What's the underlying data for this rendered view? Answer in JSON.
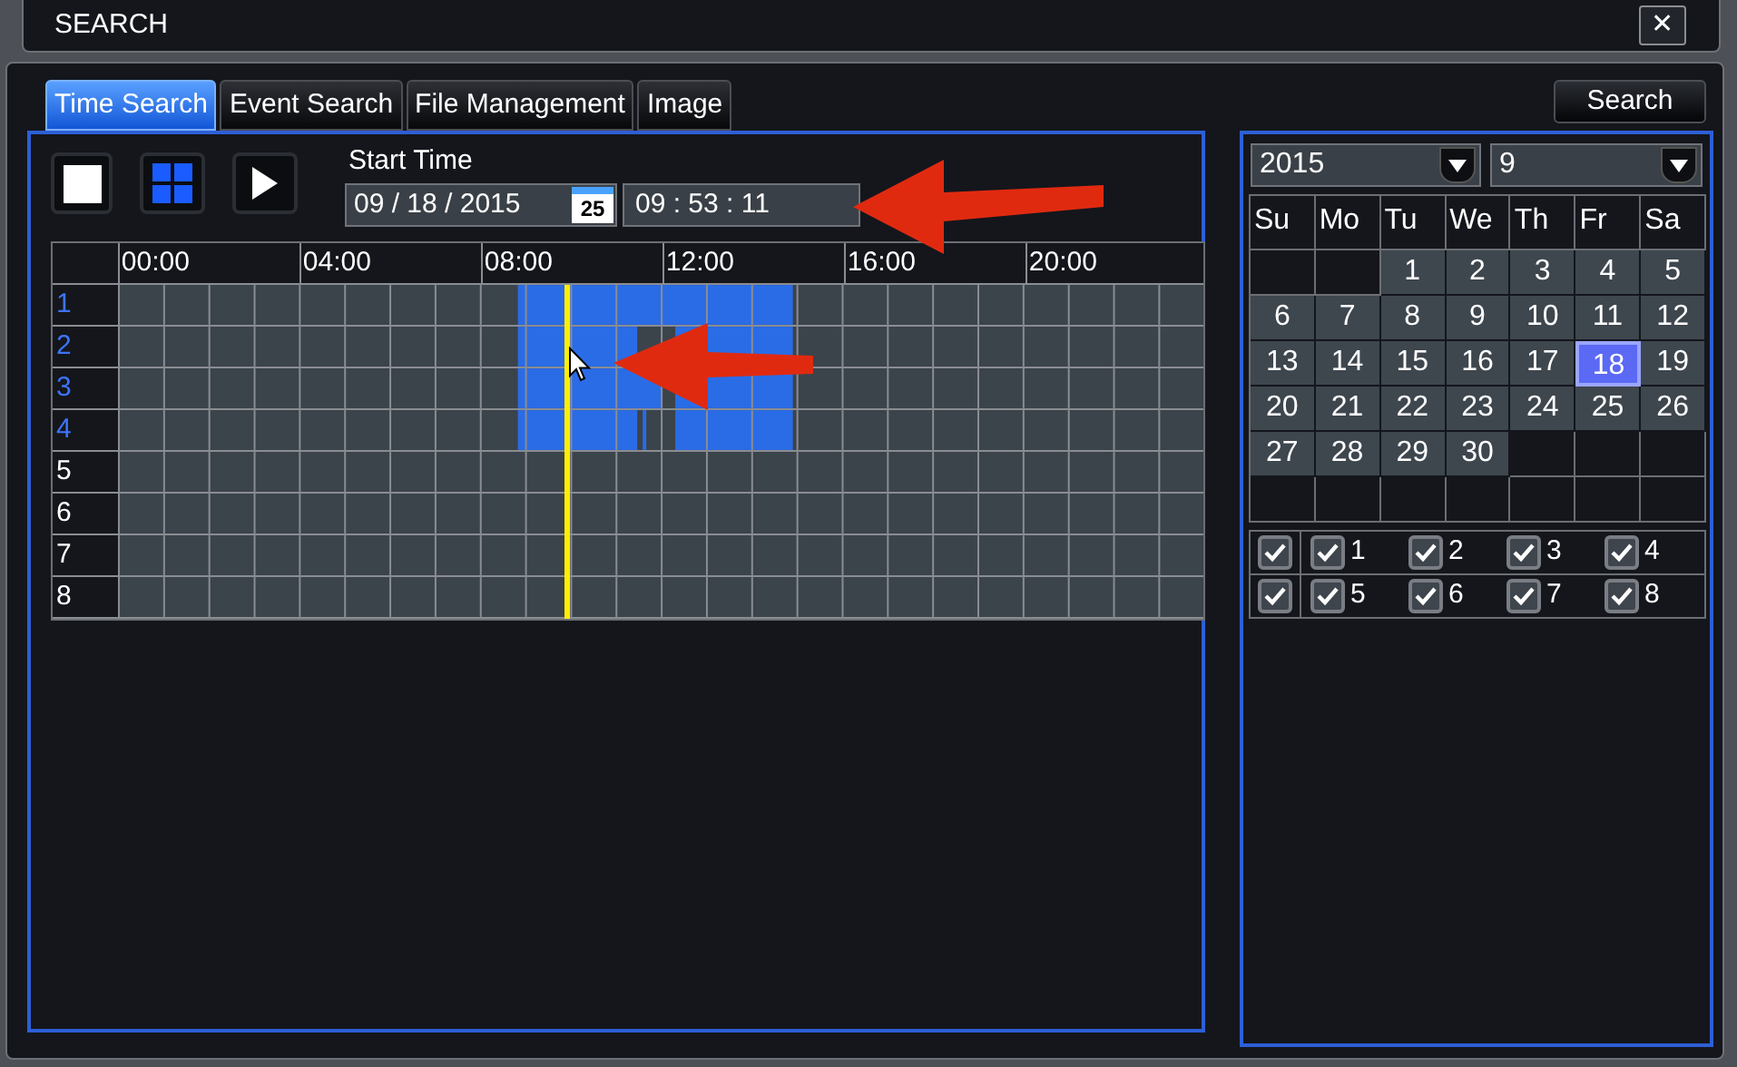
{
  "window": {
    "title": "SEARCH",
    "close": "✕"
  },
  "tabs": [
    {
      "label": "Time Search",
      "selected": true
    },
    {
      "label": "Event Search",
      "selected": false
    },
    {
      "label": "File Management",
      "selected": false
    },
    {
      "label": "Image",
      "selected": false
    }
  ],
  "search_button": "Search",
  "start_time": {
    "label": "Start Time",
    "date": "09 / 18 / 2015",
    "calendar_icon_text": "25",
    "time": "09 : 53 : 11"
  },
  "timeline": {
    "hours": [
      "00:00",
      "04:00",
      "08:00",
      "12:00",
      "16:00",
      "20:00"
    ],
    "channels": [
      {
        "label": "1",
        "highlighted": true
      },
      {
        "label": "2",
        "highlighted": true
      },
      {
        "label": "3",
        "highlighted": true
      },
      {
        "label": "4",
        "highlighted": true
      },
      {
        "label": "5",
        "highlighted": false
      },
      {
        "label": "6",
        "highlighted": false
      },
      {
        "label": "7",
        "highlighted": false
      },
      {
        "label": "8",
        "highlighted": false
      }
    ]
  },
  "calendar": {
    "year": "2015",
    "month": "9",
    "weekdays": [
      "Su",
      "Mo",
      "Tu",
      "We",
      "Th",
      "Fr",
      "Sa"
    ],
    "days": [
      {
        "kind": "blank"
      },
      {
        "kind": "blank"
      },
      {
        "kind": "day",
        "label": "1",
        "selected": false
      },
      {
        "kind": "day",
        "label": "2",
        "selected": false
      },
      {
        "kind": "day",
        "label": "3",
        "selected": false
      },
      {
        "kind": "day",
        "label": "4",
        "selected": false
      },
      {
        "kind": "day",
        "label": "5",
        "selected": false
      },
      {
        "kind": "day",
        "label": "6",
        "selected": false
      },
      {
        "kind": "day",
        "label": "7",
        "selected": false
      },
      {
        "kind": "day",
        "label": "8",
        "selected": false
      },
      {
        "kind": "day",
        "label": "9",
        "selected": false
      },
      {
        "kind": "day",
        "label": "10",
        "selected": false
      },
      {
        "kind": "day",
        "label": "11",
        "selected": false
      },
      {
        "kind": "day",
        "label": "12",
        "selected": false
      },
      {
        "kind": "day",
        "label": "13",
        "selected": false
      },
      {
        "kind": "day",
        "label": "14",
        "selected": false
      },
      {
        "kind": "day",
        "label": "15",
        "selected": false
      },
      {
        "kind": "day",
        "label": "16",
        "selected": false
      },
      {
        "kind": "day",
        "label": "17",
        "selected": false
      },
      {
        "kind": "day",
        "label": "18",
        "selected": true
      },
      {
        "kind": "day",
        "label": "19",
        "selected": false
      },
      {
        "kind": "day",
        "label": "20",
        "selected": false
      },
      {
        "kind": "day",
        "label": "21",
        "selected": false
      },
      {
        "kind": "day",
        "label": "22",
        "selected": false
      },
      {
        "kind": "day",
        "label": "23",
        "selected": false
      },
      {
        "kind": "day",
        "label": "24",
        "selected": false
      },
      {
        "kind": "day",
        "label": "25",
        "selected": false
      },
      {
        "kind": "day",
        "label": "26",
        "selected": false
      },
      {
        "kind": "day",
        "label": "27",
        "selected": false
      },
      {
        "kind": "day",
        "label": "28",
        "selected": false
      },
      {
        "kind": "day",
        "label": "29",
        "selected": false
      },
      {
        "kind": "day",
        "label": "30",
        "selected": false
      },
      {
        "kind": "blank"
      },
      {
        "kind": "blank"
      },
      {
        "kind": "blank"
      },
      {
        "kind": "blank"
      },
      {
        "kind": "blank"
      },
      {
        "kind": "blank"
      },
      {
        "kind": "blank"
      },
      {
        "kind": "blank"
      },
      {
        "kind": "blank"
      },
      {
        "kind": "blank"
      }
    ]
  },
  "channel_select": [
    {
      "all_checked": true,
      "channels": [
        {
          "label": "1",
          "checked": true
        },
        {
          "label": "2",
          "checked": true
        },
        {
          "label": "3",
          "checked": true
        },
        {
          "label": "4",
          "checked": true
        }
      ]
    },
    {
      "all_checked": true,
      "channels": [
        {
          "label": "5",
          "checked": true
        },
        {
          "label": "6",
          "checked": true
        },
        {
          "label": "7",
          "checked": true
        },
        {
          "label": "8",
          "checked": true
        }
      ]
    }
  ]
}
